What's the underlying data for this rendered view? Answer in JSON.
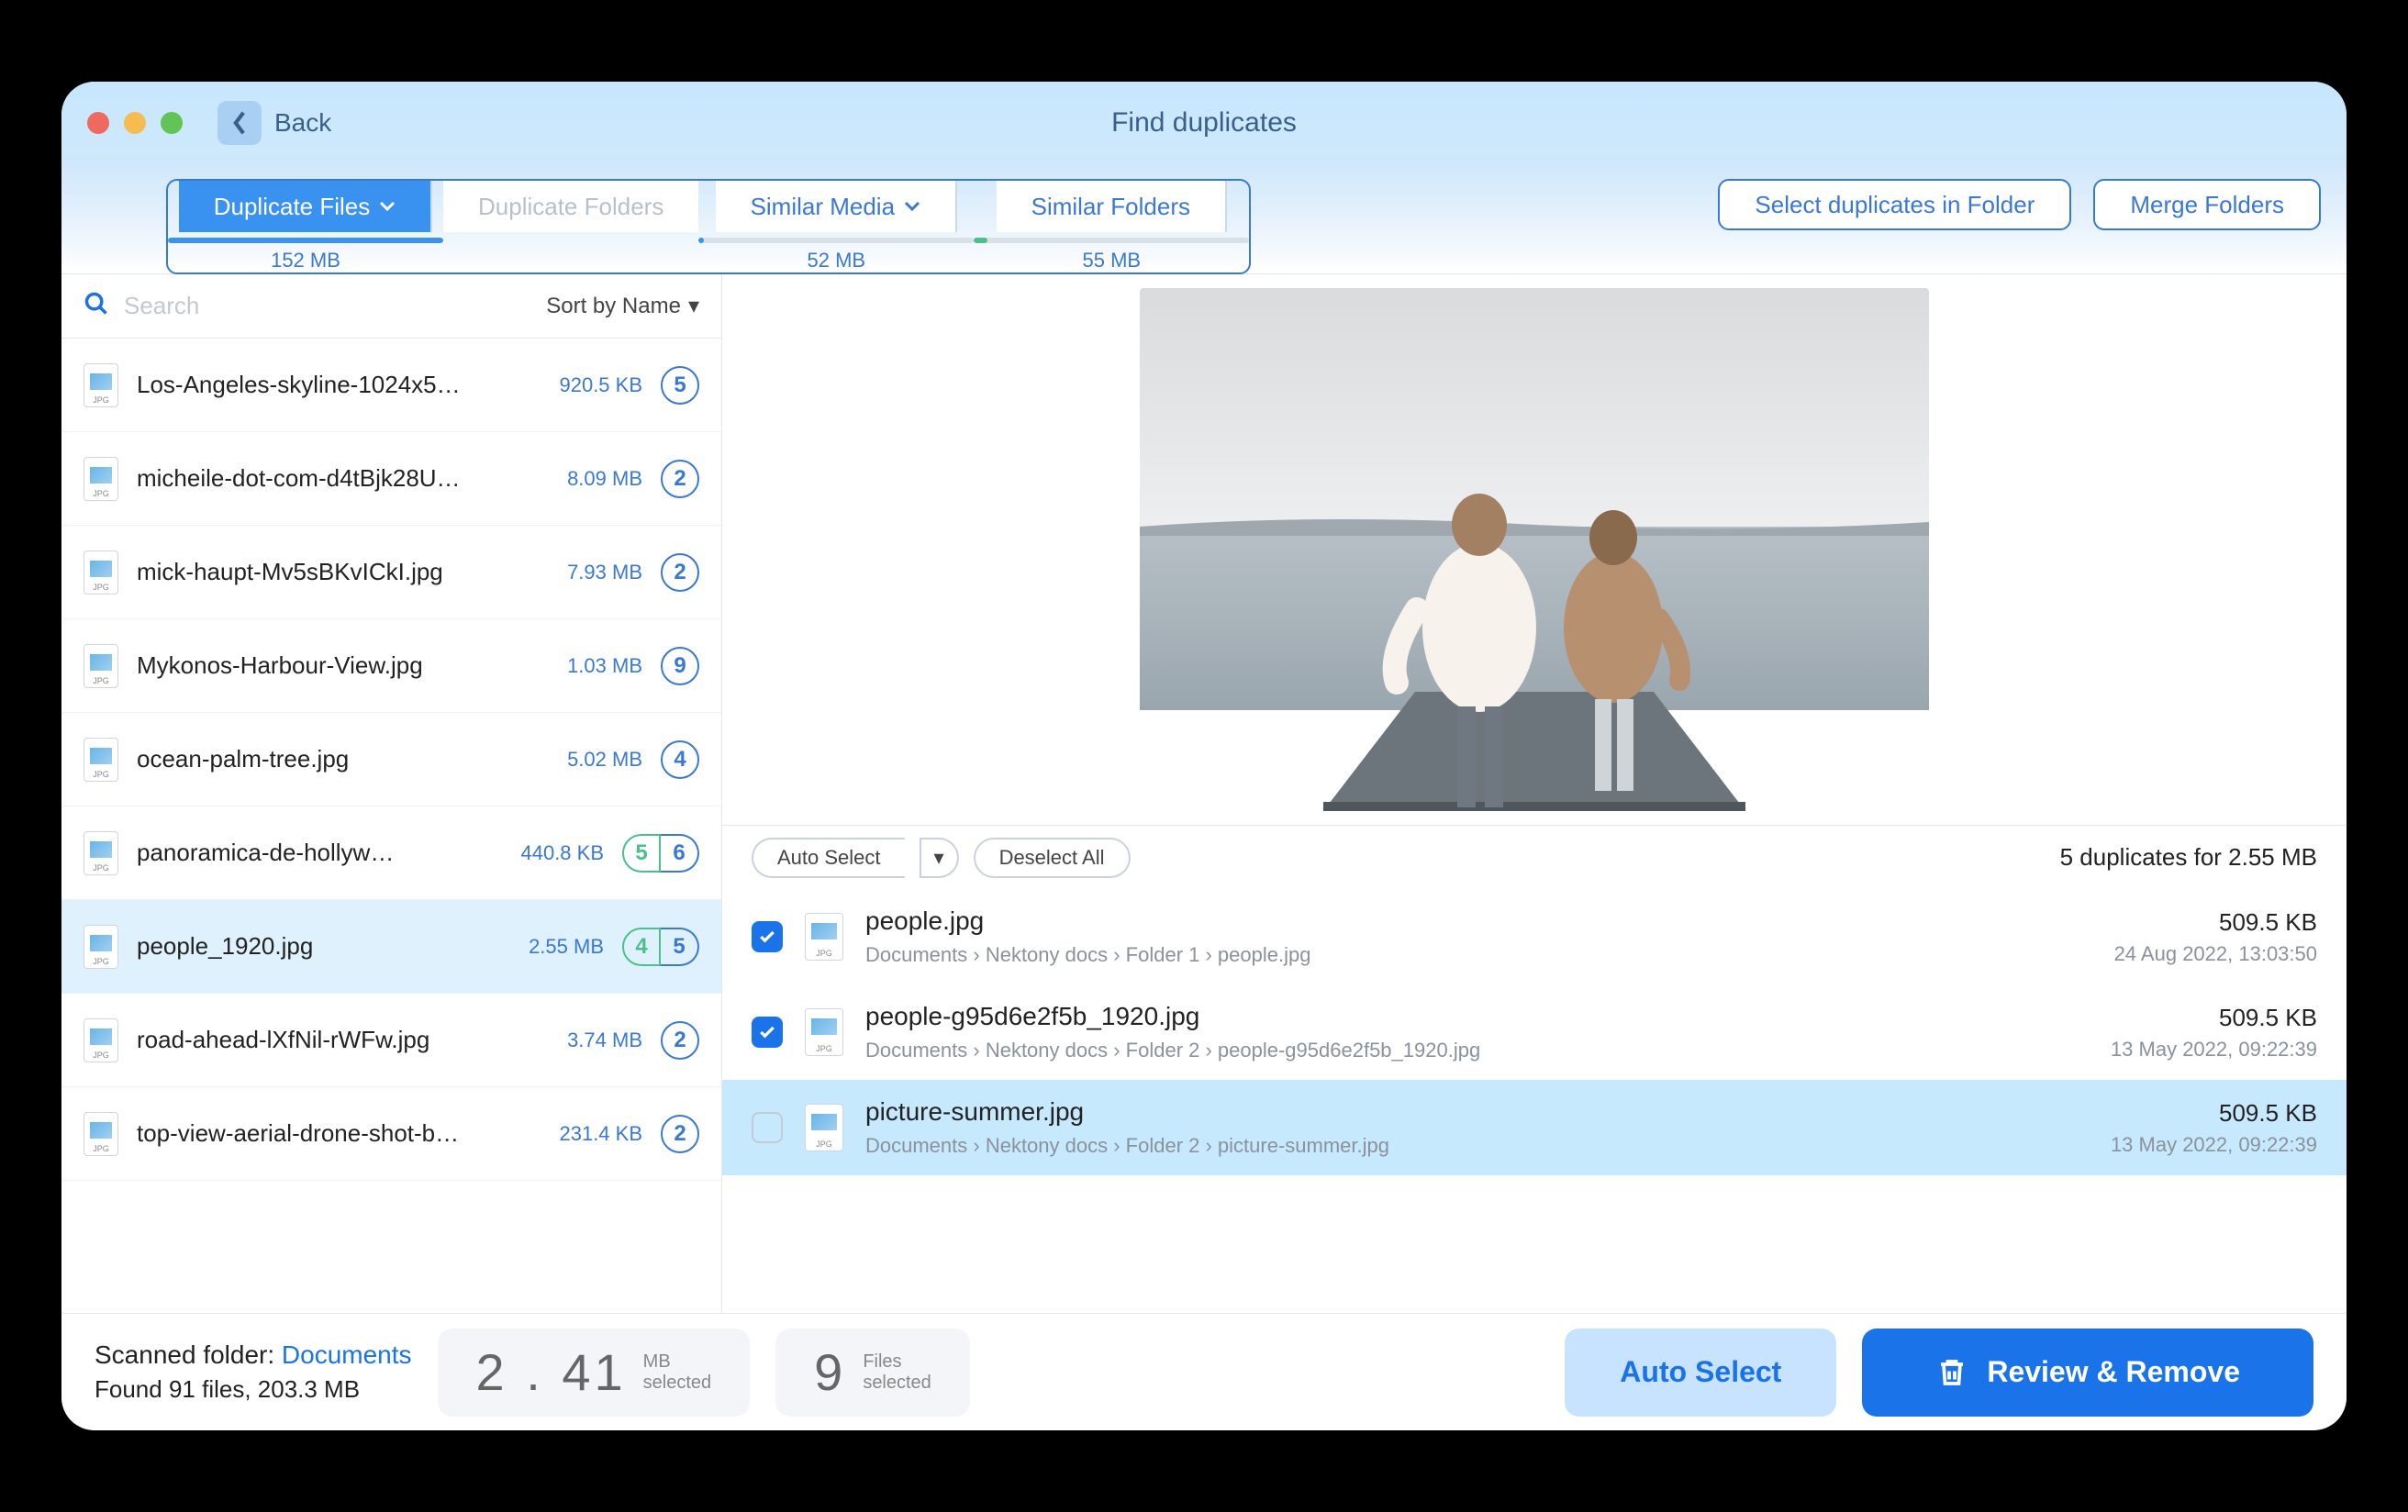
{
  "window": {
    "back_label": "Back",
    "title": "Find duplicates"
  },
  "tabs": {
    "duplicate_files": "Duplicate Files",
    "duplicate_folders": "Duplicate Folders",
    "similar_media": "Similar Media",
    "similar_folders": "Similar Folders",
    "sizes": {
      "files": "152 MB",
      "media": "52 MB",
      "folders": "55 MB"
    }
  },
  "toolbar": {
    "select_in_folder": "Select duplicates in Folder",
    "merge_folders": "Merge Folders"
  },
  "search": {
    "placeholder": "Search",
    "sort_label": "Sort by Name"
  },
  "file_list": [
    {
      "name": "Los-Angeles-skyline-1024x5…",
      "size": "920.5 KB",
      "badges": [
        "5"
      ],
      "badge_colors": [
        "blue"
      ]
    },
    {
      "name": "micheile-dot-com-d4tBjk28U…",
      "size": "8.09 MB",
      "badges": [
        "2"
      ],
      "badge_colors": [
        "blue"
      ]
    },
    {
      "name": "mick-haupt-Mv5sBKvICkI.jpg",
      "size": "7.93 MB",
      "badges": [
        "2"
      ],
      "badge_colors": [
        "blue"
      ]
    },
    {
      "name": "Mykonos-Harbour-View.jpg",
      "size": "1.03 MB",
      "badges": [
        "9"
      ],
      "badge_colors": [
        "blue"
      ]
    },
    {
      "name": "ocean-palm-tree.jpg",
      "size": "5.02 MB",
      "badges": [
        "4"
      ],
      "badge_colors": [
        "blue"
      ]
    },
    {
      "name": "panoramica-de-hollyw…",
      "size": "440.8 KB",
      "badges": [
        "5",
        "6"
      ],
      "badge_colors": [
        "green",
        "blue"
      ]
    },
    {
      "name": "people_1920.jpg",
      "size": "2.55 MB",
      "badges": [
        "4",
        "5"
      ],
      "badge_colors": [
        "green",
        "blue"
      ],
      "selected": true
    },
    {
      "name": "road-ahead-lXfNil-rWFw.jpg",
      "size": "3.74 MB",
      "badges": [
        "2"
      ],
      "badge_colors": [
        "blue"
      ]
    },
    {
      "name": "top-view-aerial-drone-shot-b…",
      "size": "231.4 KB",
      "badges": [
        "2"
      ],
      "badge_colors": [
        "blue"
      ]
    }
  ],
  "actions": {
    "auto_select": "Auto Select",
    "deselect_all": "Deselect All"
  },
  "dup_summary": "5 duplicates for 2.55 MB",
  "duplicates": [
    {
      "name": "people.jpg",
      "path": "Documents › Nektony docs › Folder 1 › people.jpg",
      "size": "509.5 KB",
      "date": "24 Aug 2022, 13:03:50",
      "checked": true,
      "hilite": false
    },
    {
      "name": "people-g95d6e2f5b_1920.jpg",
      "path": "Documents › Nektony docs › Folder 2 › people-g95d6e2f5b_1920.jpg",
      "size": "509.5 KB",
      "date": "13 May 2022, 09:22:39",
      "checked": true,
      "hilite": false
    },
    {
      "name": "picture-summer.jpg",
      "path": "Documents › Nektony docs › Folder 2 › picture-summer.jpg",
      "size": "509.5 KB",
      "date": "13 May 2022, 09:22:39",
      "checked": false,
      "hilite": true
    }
  ],
  "bottom": {
    "scanned_prefix": "Scanned folder: ",
    "scanned_folder": "Documents",
    "found_line": "Found 91 files, 203.3 MB",
    "sel_mb_value": "2 . 41",
    "sel_mb_unit": "MB",
    "sel_mb_word": "selected",
    "sel_files_value": "9",
    "sel_files_unit": "Files",
    "sel_files_word": "selected",
    "auto_select_big": "Auto Select",
    "review_remove": "Review & Remove"
  }
}
